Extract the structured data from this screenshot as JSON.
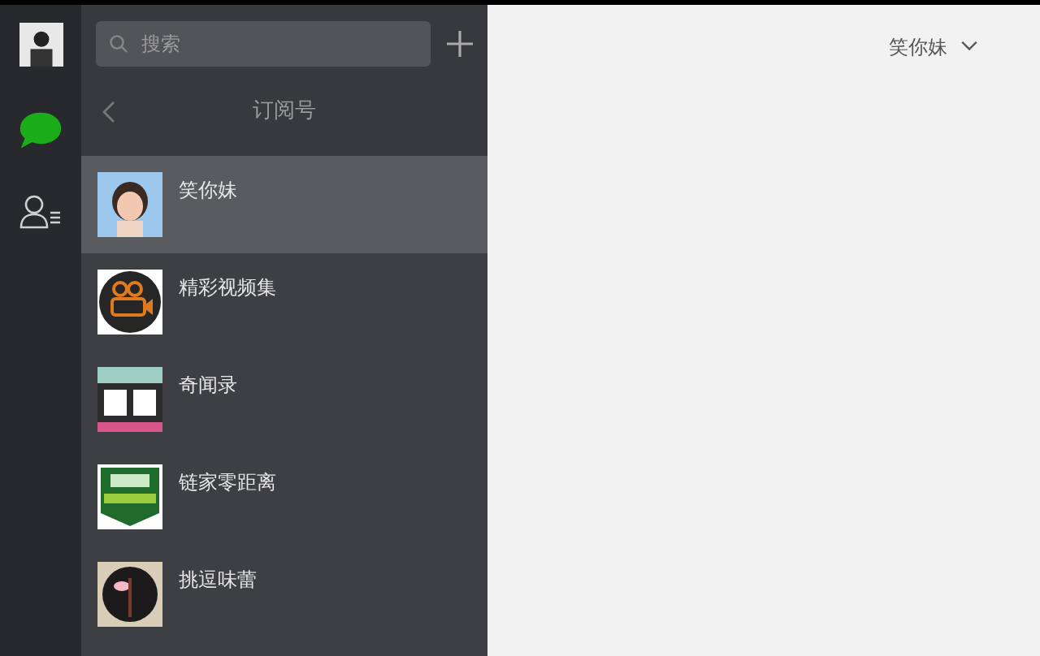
{
  "nav": [
    {
      "kind": "chat",
      "selected": true
    },
    {
      "kind": "contacts",
      "selected": false
    }
  ],
  "search": {
    "placeholder": "搜索"
  },
  "list_header": {
    "title": "订阅号"
  },
  "subscriptions": [
    {
      "name": "笑你妹",
      "selected": true
    },
    {
      "name": "精彩视频集",
      "selected": false
    },
    {
      "name": "奇闻录",
      "selected": false
    },
    {
      "name": "链家零距离",
      "selected": false
    },
    {
      "name": "挑逗味蕾",
      "selected": false
    }
  ],
  "chat": {
    "title": "笑你妹"
  }
}
